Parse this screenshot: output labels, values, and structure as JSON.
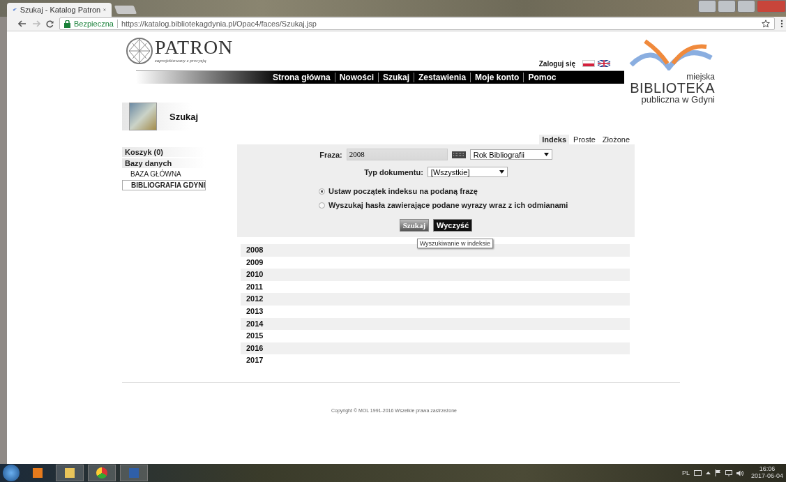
{
  "browser": {
    "tab_title": "Szukaj - Katalog Patron",
    "security_label": "Bezpieczna",
    "url": "https://katalog.bibliotekagdynia.pl/Opac4/faces/Szukaj.jsp"
  },
  "header": {
    "logo_title": "PATRON",
    "logo_subtitle": "zaprojektowany z precyzją",
    "login": "Zaloguj się",
    "library_logo": [
      "miejska",
      "BIBLIOTEKA",
      "publiczna w Gdyni"
    ]
  },
  "nav": [
    "Strona główna",
    "Nowości",
    "Szukaj",
    "Zestawienia",
    "Moje konto",
    "Pomoc"
  ],
  "page_title": "Szukaj",
  "search_tabs": [
    {
      "label": "Indeks",
      "selected": true
    },
    {
      "label": "Proste",
      "selected": false
    },
    {
      "label": "Złożone",
      "selected": false
    }
  ],
  "sidebar": {
    "items": [
      {
        "label": "Koszyk (0)",
        "kind": "heading",
        "selected": false
      },
      {
        "label": "Bazy danych",
        "kind": "heading",
        "selected": false
      },
      {
        "label": "BAZA GŁÓWNA",
        "kind": "link",
        "selected": false
      },
      {
        "label": "BIBLIOGRAFIA GDYNI",
        "kind": "link",
        "selected": true
      }
    ]
  },
  "form": {
    "phrase_label": "Fraza:",
    "phrase_value": "2008",
    "index_select": "Rok Bibliografii",
    "doc_type_label": "Typ dokumentu:",
    "doc_type_select": "[Wszystkie]",
    "options": [
      {
        "label": "Ustaw początek indeksu na podaną frazę",
        "selected": true
      },
      {
        "label": "Wyszukaj hasła zawierające podane wyrazy wraz z ich odmianami",
        "selected": false
      }
    ],
    "buttons": [
      "Szukaj",
      "Wyczyść"
    ],
    "tooltip": "Wyszukiwanie w indeksie"
  },
  "results": [
    "2008",
    "2009",
    "2010",
    "2011",
    "2012",
    "2013",
    "2014",
    "2015",
    "2016",
    "2017"
  ],
  "footer": "Copyright © MOL 1991-2016 Wszelkie prawa zastrzeżone",
  "taskbar": {
    "language": "PL",
    "time": "16:06",
    "date": "2017-06-04"
  }
}
